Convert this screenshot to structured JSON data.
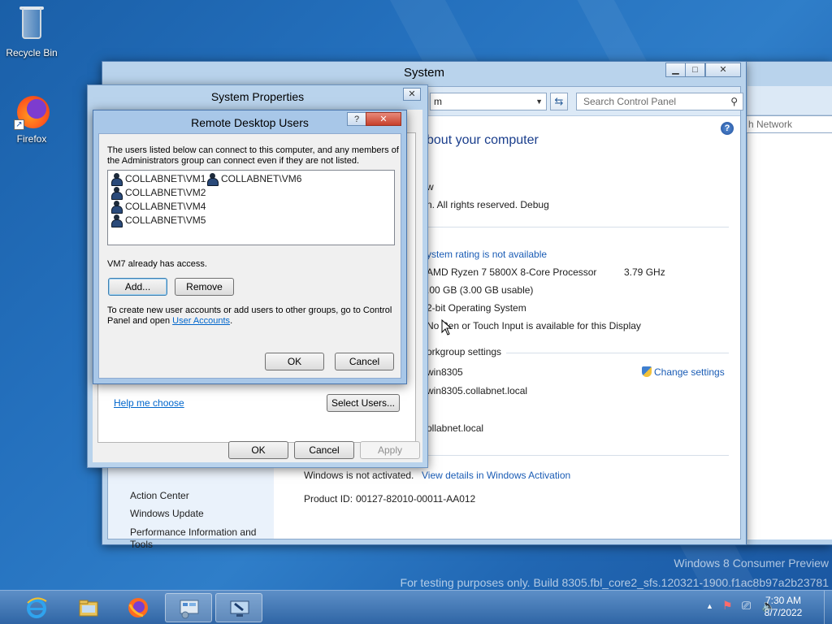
{
  "desktop": {
    "icons": [
      {
        "label": "Recycle Bin"
      },
      {
        "label": "Firefox"
      }
    ],
    "watermark_line1": "Windows 8 Consumer Preview",
    "watermark_line2": "For testing purposes only. Build 8305.fbl_core2_sfs.120321-1900.f1ac8b97a2b23781"
  },
  "system_window": {
    "title": "System",
    "address_tail": "m",
    "search_placeholder": "Search Control Panel",
    "heading": "bout your computer",
    "edition_fragment": "w",
    "copyright": "n. All rights reserved. Debug",
    "rating_link": "ystem rating is not available",
    "processor": "AMD Ryzen 7 5800X 8-Core Processor",
    "processor_speed": "3.79 GHz",
    "ram": ".00 GB (3.00 GB usable)",
    "system_type": "2-bit Operating System",
    "pen_touch": "No Pen or Touch Input is available for this Display",
    "section_workgroup": "orkgroup settings",
    "computer_name": "win8305",
    "full_name": "win8305.collabnet.local",
    "domain": "ollabnet.local",
    "change_settings": "Change settings",
    "activation_status": "Windows is not activated.",
    "activation_link": "View details in Windows Activation",
    "product_id_label": "Product ID:",
    "product_id": "00127-82010-00011-AA012",
    "see_also": [
      "Action Center",
      "Windows Update",
      "Performance Information and Tools"
    ]
  },
  "network_window": {
    "search_tail": "h Network"
  },
  "system_properties": {
    "title": "System Properties",
    "help_me_choose": "Help me choose",
    "select_users": "Select Users...",
    "ok": "OK",
    "cancel": "Cancel",
    "apply": "Apply"
  },
  "rdu_dialog": {
    "title": "Remote Desktop Users",
    "help_btn": "?",
    "intro": "The users listed below can connect to this computer, and any members of the Administrators group can connect even if they are not listed.",
    "users": [
      "COLLABNET\\VM1",
      "COLLABNET\\VM6",
      "COLLABNET\\VM2",
      "COLLABNET\\VM4",
      "COLLABNET\\VM5"
    ],
    "already_access": "VM7 already has access.",
    "add": "Add...",
    "remove": "Remove",
    "footer_text": "To create new user accounts or add users to other groups, go to Control Panel and open",
    "footer_link": "User Accounts",
    "footer_end": ".",
    "ok": "OK",
    "cancel": "Cancel"
  },
  "taskbar": {
    "time": "7:30 AM",
    "date": "8/7/2022"
  }
}
